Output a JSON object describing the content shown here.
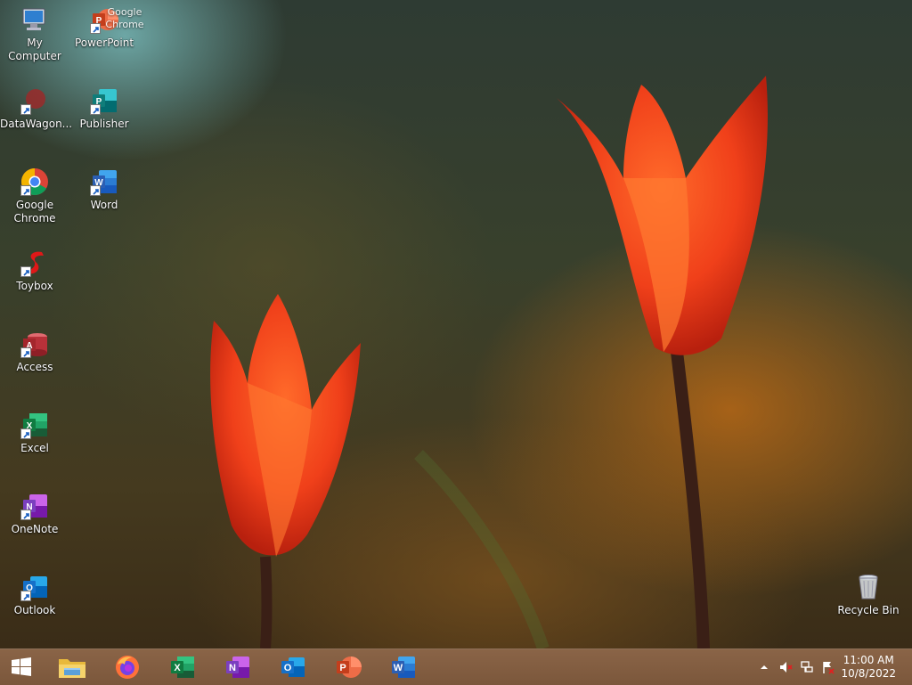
{
  "desktop": {
    "icons": [
      {
        "label": "My Computer"
      },
      {
        "label": "Google\nChrome"
      },
      {
        "label": "PowerPoint"
      },
      {
        "label": "DataWagon..."
      },
      {
        "label": "Publisher"
      },
      {
        "label": "Google Chrome"
      },
      {
        "label": "Word"
      },
      {
        "label": "Toybox"
      },
      {
        "label": "Access"
      },
      {
        "label": "Excel"
      },
      {
        "label": "OneNote"
      },
      {
        "label": "Outlook"
      },
      {
        "label": "Recycle Bin"
      }
    ]
  },
  "taskbar": {
    "pinned": [
      {
        "name": "File Explorer",
        "icon": "folder-icon"
      },
      {
        "name": "Firefox",
        "icon": "firefox-icon"
      },
      {
        "name": "Excel",
        "icon": "excel-icon",
        "letter": "X"
      },
      {
        "name": "OneNote",
        "icon": "onenote-icon",
        "letter": "N"
      },
      {
        "name": "Outlook",
        "icon": "outlook-icon",
        "letter": "O"
      },
      {
        "name": "PowerPoint",
        "icon": "powerpoint-icon",
        "letter": "P"
      },
      {
        "name": "Word",
        "icon": "word-icon",
        "letter": "W"
      }
    ],
    "clock": {
      "time": "11:00 AM",
      "date": "10/8/2022"
    }
  },
  "colors": {
    "taskbar": "#7b573b",
    "excel": "#1d7a44",
    "word": "#2b5fb4",
    "powerpoint": "#d14424",
    "onenote": "#7b3fbf",
    "outlook": "#1570c9",
    "access": "#b83139",
    "publisher": "#0f7d7a"
  }
}
